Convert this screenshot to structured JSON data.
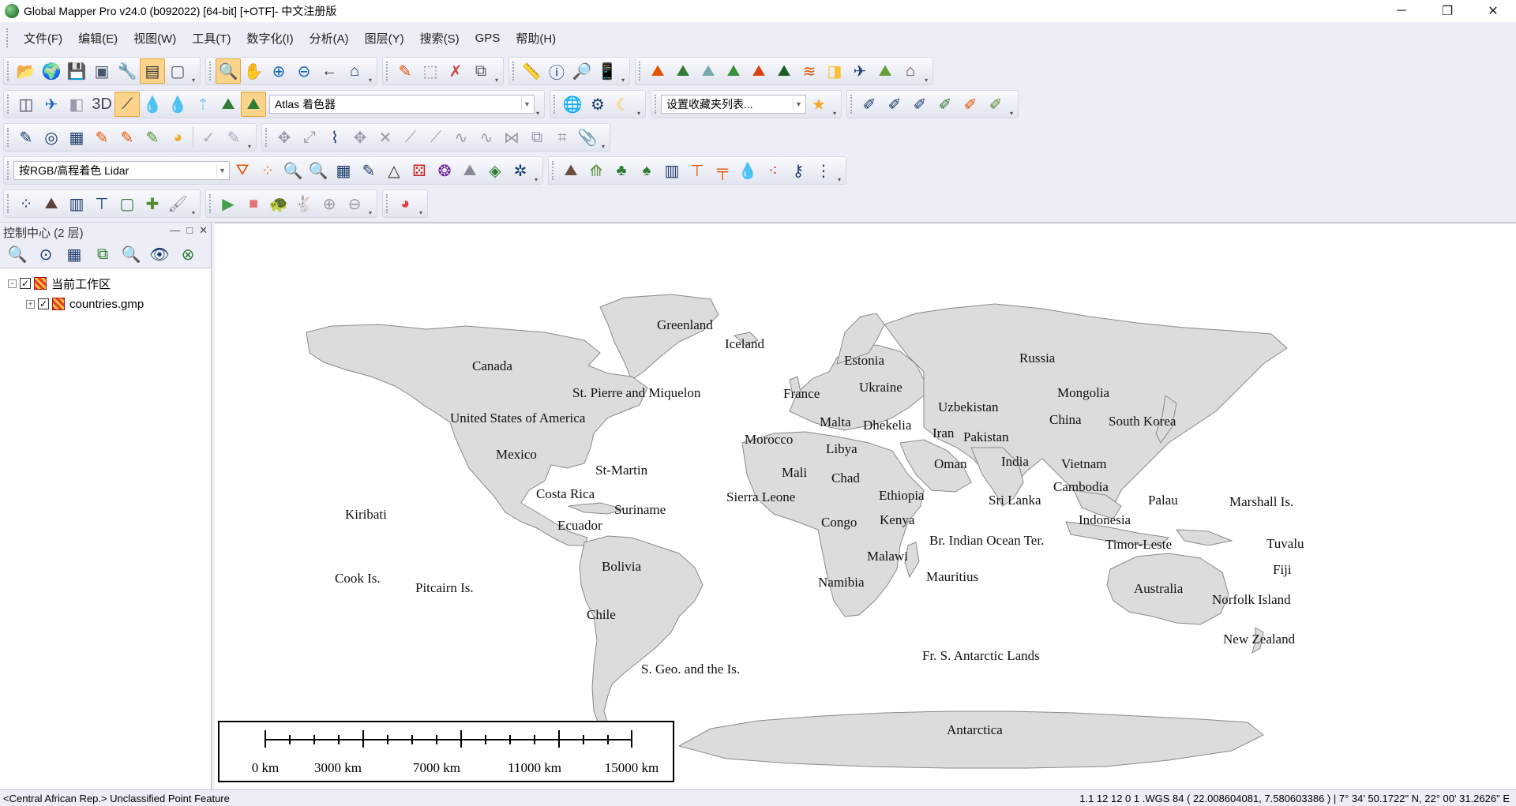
{
  "window": {
    "title": "Global Mapper Pro v24.0 (b092022) [64-bit] [+OTF]- 中文注册版",
    "minimize": "─",
    "restore": "❐",
    "close": "✕"
  },
  "menu": [
    "文件(F)",
    "编辑(E)",
    "视图(W)",
    "工具(T)",
    "数字化(I)",
    "分析(A)",
    "图层(Y)",
    "搜索(S)",
    "GPS",
    "帮助(H)"
  ],
  "toolbar": {
    "shader_combo": "Atlas 着色器",
    "favorites_combo": "设置收藏夹列表...",
    "lidar_combo": "按RGB/高程着色 Lidar"
  },
  "control_center": {
    "title": "控制中心 (2 层)",
    "minimize": "—",
    "maximize": "□",
    "close": "✕",
    "tree": [
      {
        "label": "当前工作区",
        "expand": "−",
        "checked": "✓"
      },
      {
        "label": "countries.gmp",
        "expand": "+",
        "checked": "✓"
      }
    ]
  },
  "map": {
    "labels": [
      {
        "id": "greenland",
        "text": "Greenland"
      },
      {
        "id": "iceland",
        "text": "Iceland"
      },
      {
        "id": "canada",
        "text": "Canada"
      },
      {
        "id": "stpierre",
        "text": "St. Pierre and Miquelon"
      },
      {
        "id": "usa",
        "text": "United States of America"
      },
      {
        "id": "mexico",
        "text": "Mexico"
      },
      {
        "id": "stmartin",
        "text": "St-Martin"
      },
      {
        "id": "costarica",
        "text": "Costa Rica"
      },
      {
        "id": "suriname",
        "text": "Suriname"
      },
      {
        "id": "ecuador",
        "text": "Ecuador"
      },
      {
        "id": "bolivia",
        "text": "Bolivia"
      },
      {
        "id": "chile",
        "text": "Chile"
      },
      {
        "id": "sgeo",
        "text": "S. Geo. and the Is."
      },
      {
        "id": "kiribati",
        "text": "Kiribati"
      },
      {
        "id": "cook",
        "text": "Cook Is."
      },
      {
        "id": "pitcairn",
        "text": "Pitcairn Is."
      },
      {
        "id": "estonia",
        "text": "Estonia"
      },
      {
        "id": "russia",
        "text": "Russia"
      },
      {
        "id": "france",
        "text": "France"
      },
      {
        "id": "ukraine",
        "text": "Ukraine"
      },
      {
        "id": "mongolia",
        "text": "Mongolia"
      },
      {
        "id": "uzbekistan",
        "text": "Uzbekistan"
      },
      {
        "id": "malta",
        "text": "Malta"
      },
      {
        "id": "dhekelia",
        "text": "Dhekelia"
      },
      {
        "id": "china",
        "text": "China"
      },
      {
        "id": "southkorea",
        "text": "South Korea"
      },
      {
        "id": "iran",
        "text": "Iran"
      },
      {
        "id": "pakistan",
        "text": "Pakistan"
      },
      {
        "id": "morocco",
        "text": "Morocco"
      },
      {
        "id": "libya",
        "text": "Libya"
      },
      {
        "id": "oman",
        "text": "Oman"
      },
      {
        "id": "india",
        "text": "India"
      },
      {
        "id": "vietnam",
        "text": "Vietnam"
      },
      {
        "id": "mali",
        "text": "Mali"
      },
      {
        "id": "chad",
        "text": "Chad"
      },
      {
        "id": "cambodia",
        "text": "Cambodia"
      },
      {
        "id": "sierraleone",
        "text": "Sierra Leone"
      },
      {
        "id": "ethiopia",
        "text": "Ethiopia"
      },
      {
        "id": "srilanka",
        "text": "Sri Lanka"
      },
      {
        "id": "palau",
        "text": "Palau"
      },
      {
        "id": "marshall",
        "text": "Marshall Is."
      },
      {
        "id": "congo",
        "text": "Congo"
      },
      {
        "id": "kenya",
        "text": "Kenya"
      },
      {
        "id": "indonesia",
        "text": "Indonesia"
      },
      {
        "id": "brindian",
        "text": "Br. Indian Ocean Ter."
      },
      {
        "id": "timorleste",
        "text": "Timor-Leste"
      },
      {
        "id": "tuvalu",
        "text": "Tuvalu"
      },
      {
        "id": "malawi",
        "text": "Malawi"
      },
      {
        "id": "fiji",
        "text": "Fiji"
      },
      {
        "id": "mauritius",
        "text": "Mauritius"
      },
      {
        "id": "namibia",
        "text": "Namibia"
      },
      {
        "id": "australia",
        "text": "Australia"
      },
      {
        "id": "norfolk",
        "text": "Norfolk Island"
      },
      {
        "id": "newzealand",
        "text": "New Zealand"
      },
      {
        "id": "frsantarctic",
        "text": "Fr. S. Antarctic Lands"
      },
      {
        "id": "antarctica",
        "text": "Antarctica"
      }
    ]
  },
  "scalebar": {
    "labels": [
      "0 km",
      "3000 km",
      "7000 km",
      "11000 km",
      "15000 km"
    ]
  },
  "status": {
    "left": "<Central African Rep.> Unclassified Point Feature",
    "right": "1.1 12   12 0 1 .WGS 84 ( 22.008604081, 7.580603386 ) | 7° 34' 50.1722\" N, 22° 00' 31.2626\" E"
  },
  "colors": {
    "land": "#dcdcdc",
    "border": "#8a8a8a",
    "toolbar_bg": "#ecedf6",
    "active_tool": "#fbd38a"
  }
}
